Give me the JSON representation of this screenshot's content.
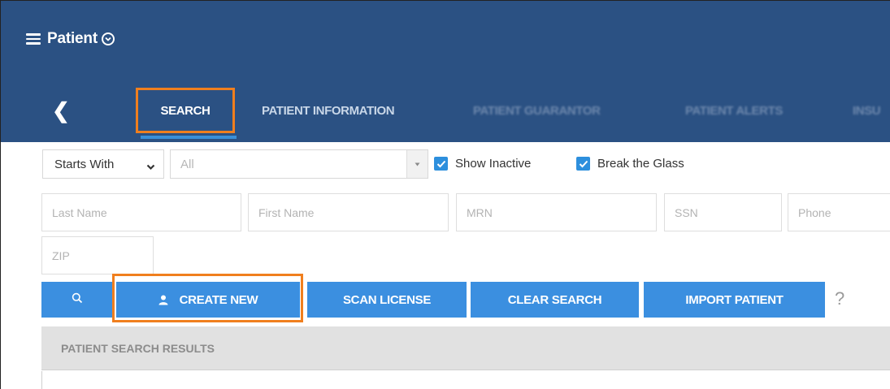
{
  "header": {
    "title": "Patient",
    "back_glyph": "❮"
  },
  "tabs": [
    {
      "label": "SEARCH",
      "active": true
    },
    {
      "label": "PATIENT INFORMATION"
    },
    {
      "label": "PATIENT GUARANTOR"
    },
    {
      "label": "PATIENT ALERTS"
    },
    {
      "label": "INSU"
    }
  ],
  "filters": {
    "match_mode": "Starts With",
    "scope_value": "All",
    "show_inactive": {
      "label": "Show Inactive",
      "checked": true
    },
    "break_the_glass": {
      "label": "Break the Glass",
      "checked": true
    }
  },
  "search_fields": {
    "last_name": "Last Name",
    "first_name": "First Name",
    "mrn": "MRN",
    "ssn": "SSN",
    "phone": "Phone",
    "zip": "ZIP"
  },
  "actions": {
    "create_new": "CREATE NEW",
    "scan_license": "SCAN LICENSE",
    "clear_search": "CLEAR SEARCH",
    "import_patient": "IMPORT PATIENT",
    "help": "?"
  },
  "results": {
    "title": "PATIENT SEARCH RESULTS"
  },
  "colors": {
    "header_bg": "#2b5183",
    "button_blue": "#3b8fe0",
    "highlight_orange": "#f07f1e",
    "checkbox_blue": "#2d8fdd"
  },
  "icons": {
    "menu": "hamburger-menu-icon",
    "collapse": "chevron-circle-icon",
    "back": "chevron-left-icon",
    "search": "search-icon",
    "user": "user-icon"
  }
}
